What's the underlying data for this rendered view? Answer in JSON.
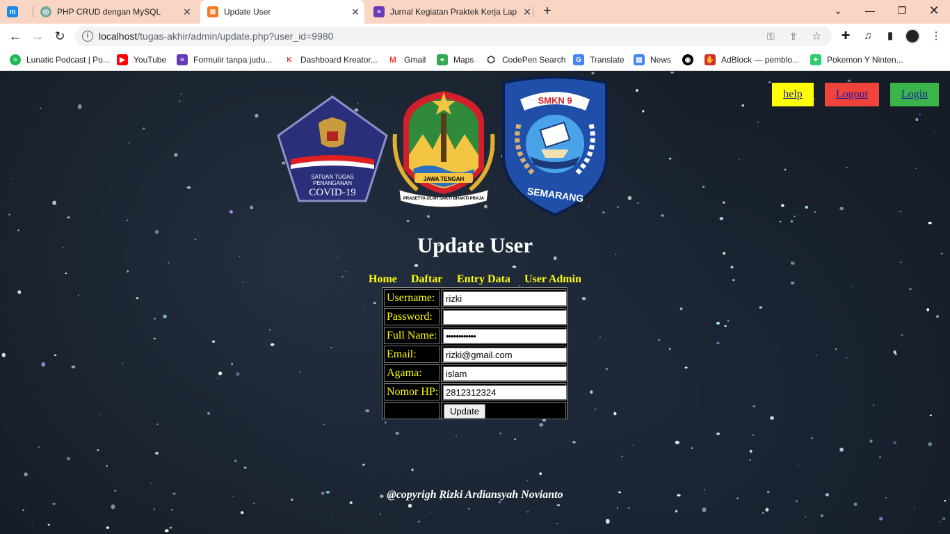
{
  "browser": {
    "tabs": [
      {
        "title": "",
        "icon": "moodle-icon"
      },
      {
        "title": "PHP CRUD dengan MySQL",
        "icon": "chatgpt-icon"
      },
      {
        "title": "Update User",
        "icon": "xampp-icon",
        "active": true
      },
      {
        "title": "Jurnal Kegiatan Praktek Kerja Lap",
        "icon": "forms-icon"
      }
    ],
    "url_host": "localhost",
    "url_path": "/tugas-akhir/admin/update.php?user_id=9980",
    "bookmarks": [
      {
        "label": "Lunatic Podcast | Po...",
        "icon": "spotify-icon",
        "color": "#1db954"
      },
      {
        "label": "YouTube",
        "icon": "youtube-icon",
        "color": "#ff0000"
      },
      {
        "label": "Formulir tanpa judu...",
        "icon": "forms-icon",
        "color": "#673ab7"
      },
      {
        "label": "Dashboard Kreator...",
        "icon": "kreator-icon",
        "color": "#e53935"
      },
      {
        "label": "Gmail",
        "icon": "gmail-icon",
        "color": "#ea4335"
      },
      {
        "label": "Maps",
        "icon": "maps-icon",
        "color": "#34a853"
      },
      {
        "label": "CodePen Search",
        "icon": "codepen-icon",
        "color": "#000000"
      },
      {
        "label": "Translate",
        "icon": "translate-icon",
        "color": "#4285f4"
      },
      {
        "label": "News",
        "icon": "news-icon",
        "color": "#4285f4"
      },
      {
        "label": "",
        "icon": "globe-icon",
        "color": "#000000"
      },
      {
        "label": "AdBlock — pemblo...",
        "icon": "adblock-icon",
        "color": "#d32f2f"
      },
      {
        "label": "Pokemon Y Ninten...",
        "icon": "pokemon-icon",
        "color": "#2ecc71"
      }
    ]
  },
  "page": {
    "buttons": {
      "help": "help",
      "logout": "Logout",
      "login": "Login"
    },
    "title": "Update User",
    "menu": [
      "Home",
      "Daftar",
      "Entry Data",
      "User Admin"
    ],
    "logos": {
      "covid_line1": "SATUAN TUGAS",
      "covid_line2": "PENANGANAN",
      "covid_line3": "COVID-19",
      "jateng_banner": "JAWA TENGAH",
      "jateng_motto": "PRASETYA ULAH SAKTI BHAKTI PRAJA",
      "smkn_top": "SMKN 9",
      "smkn_bottom": "SEMARANG"
    },
    "form": {
      "username_label": "Username:",
      "username_value": "rizki",
      "password_label": "Password:",
      "password_value": "",
      "fullname_label": "Full Name:",
      "fullname_value": "••••••••••••",
      "email_label": "Email:",
      "email_value": "rizki@gmail.com",
      "agama_label": "Agama:",
      "agama_value": "islam",
      "nomor_label": "Nomor HP:",
      "nomor_value": "2812312324",
      "update_label": "Update"
    },
    "footer": "@copyrigh Rizki Ardiansyah Novianto"
  }
}
